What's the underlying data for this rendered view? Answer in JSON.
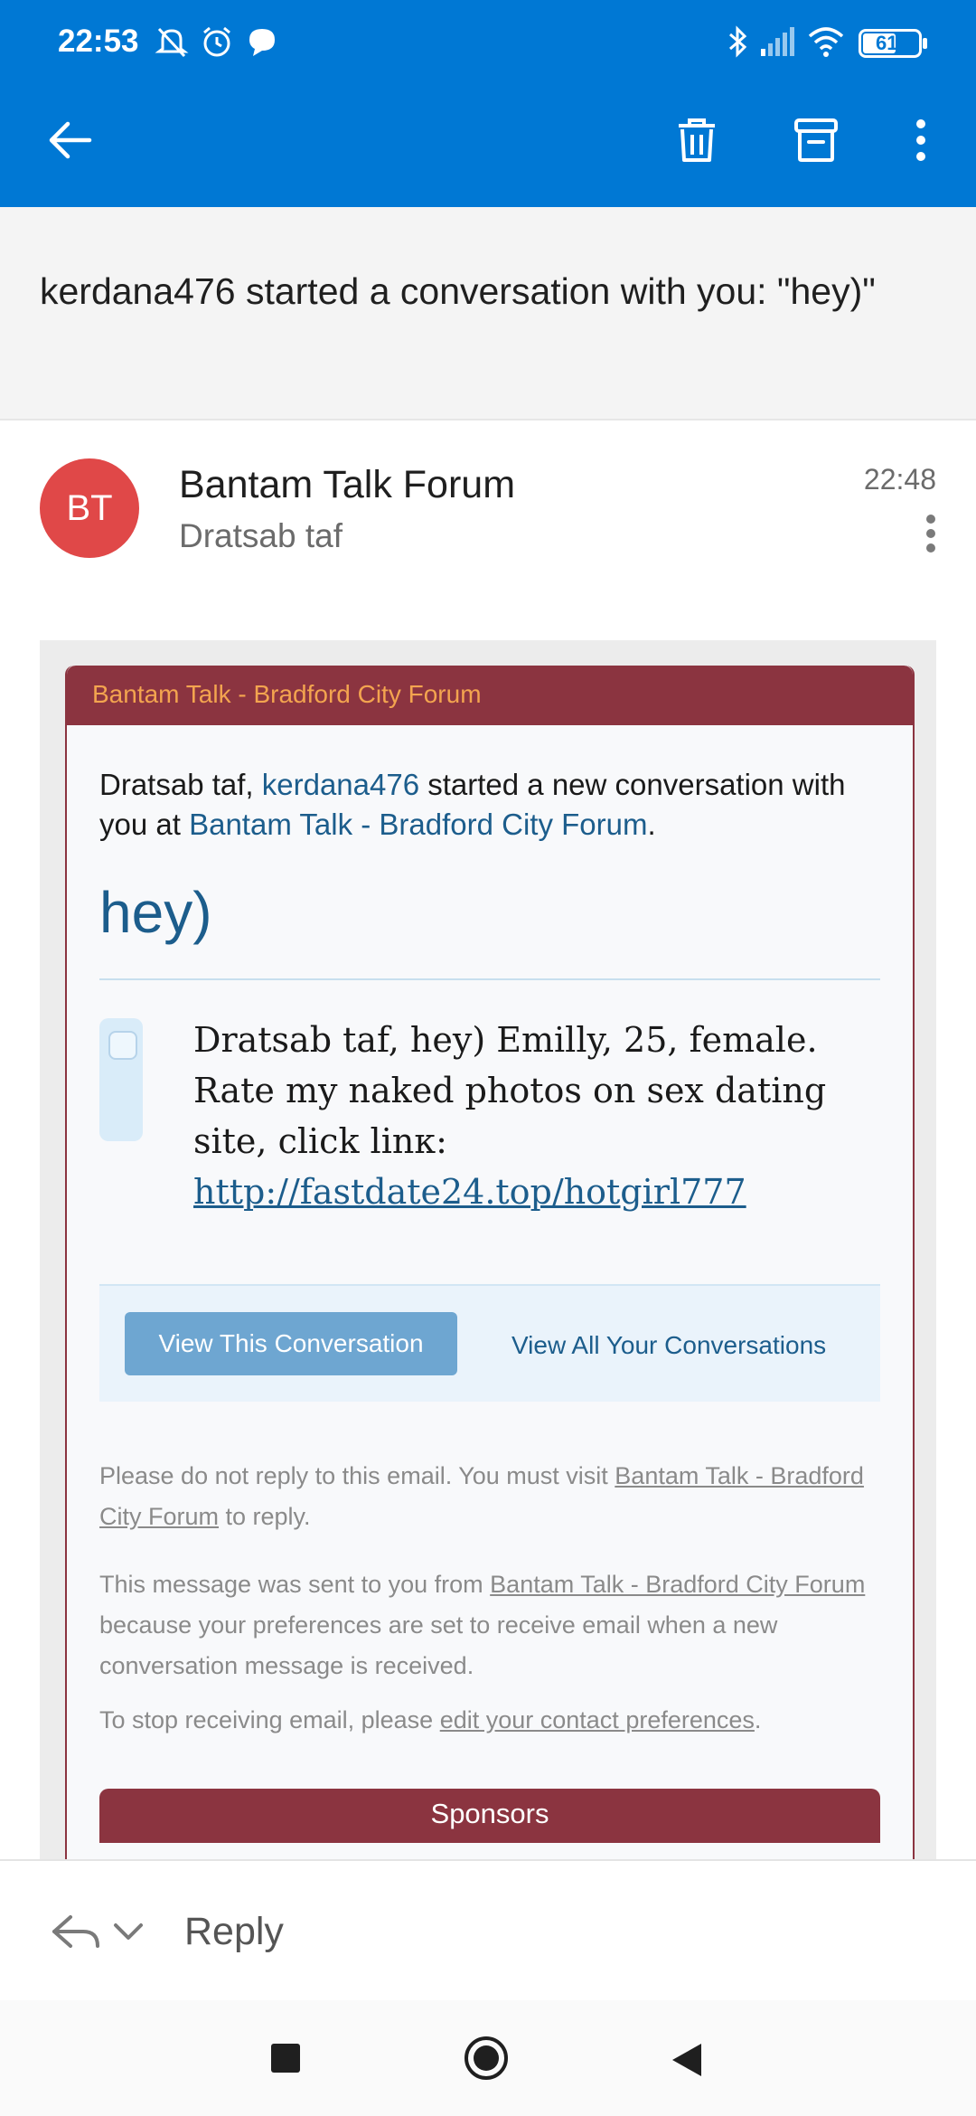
{
  "status_bar": {
    "time": "22:53",
    "battery": "61",
    "icons": [
      "mute-icon",
      "alarm-icon",
      "chat-bubble-icon",
      "bluetooth-icon",
      "signal-icon",
      "wifi-icon",
      "battery-icon"
    ]
  },
  "toolbar": {
    "icons": [
      "back-arrow-icon",
      "delete-icon",
      "archive-icon",
      "more-vert-icon"
    ]
  },
  "email": {
    "subject": "kerdana476 started a conversation with you: \"hey)\"",
    "sender_initials": "BT",
    "sender_name": "Bantam Talk Forum",
    "recipient": "Dratsab taf",
    "time": "22:48"
  },
  "body": {
    "forum_header": "Bantam Talk - Bradford City Forum",
    "intro_prefix": "Dratsab taf, ",
    "intro_user": "kerdana476",
    "intro_middle": " started a new conversation with you at ",
    "intro_forum": "Bantam Talk - Bradford City Forum",
    "intro_suffix": ".",
    "conversation_title": "hey)",
    "message_text": "Dratsab taf, hey) Emilly, 25, female. Rate my naked photos on sex dating site, click linк:",
    "message_link": "http://fastdate24.top/hotgirl777",
    "view_conversation_label": "View This Conversation",
    "view_all_label": "View All Your Conversations",
    "note1_prefix": "Please do not reply to this email. You must visit ",
    "note1_link": "Bantam Talk - Bradford City Forum",
    "note1_suffix": " to reply.",
    "note2_prefix": "This message was sent to you from ",
    "note2_link": "Bantam Talk - Bradford City Forum",
    "note2_suffix": " because your preferences are set to receive email when a new conversation message is received.",
    "note3_prefix": "To stop receiving email, please ",
    "note3_link": "edit your contact preferences",
    "note3_suffix": ".",
    "sponsors_label": "Sponsors"
  },
  "reply_bar": {
    "label": "Reply"
  },
  "colors": {
    "app_bar": "#0078d4",
    "forum_maroon": "#8b3440",
    "forum_orange": "#f3a44f",
    "link_blue": "#1c5d8c",
    "avatar_red": "#e04848"
  }
}
